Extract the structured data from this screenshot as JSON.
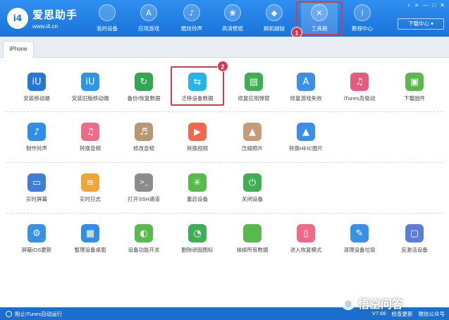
{
  "brand": {
    "logo": "i4",
    "name": "爱思助手",
    "url": "www.i4.cn"
  },
  "nav": {
    "items": [
      {
        "label": "我的设备",
        "icon": "apple-icon",
        "glyph": ""
      },
      {
        "label": "应用游戏",
        "icon": "app-store-icon",
        "glyph": "A"
      },
      {
        "label": "酷炫铃声",
        "icon": "bell-icon",
        "glyph": "♪"
      },
      {
        "label": "高清壁纸",
        "icon": "flower-icon",
        "glyph": "❀"
      },
      {
        "label": "刷机越狱",
        "icon": "dropbox-icon",
        "glyph": "◆"
      },
      {
        "label": "工具箱",
        "icon": "tools-icon",
        "glyph": "✕"
      },
      {
        "label": "教程中心",
        "icon": "info-icon",
        "glyph": "i"
      }
    ],
    "active_index": 5,
    "download_center": "下载中心 ▾"
  },
  "window_controls": [
    "♀",
    "≡",
    "—",
    "□",
    "✕"
  ],
  "badges": {
    "nav": "1",
    "tool": "2"
  },
  "tab": {
    "label": "iPhone"
  },
  "tools": {
    "row1": [
      {
        "label": "安装移动端",
        "icon": "i4-app-icon",
        "glyph": "iU",
        "color": "#2677d8"
      },
      {
        "label": "安装旧版移动端",
        "icon": "i4-legacy-app-icon",
        "glyph": "iU",
        "color": "#2f94e8"
      },
      {
        "label": "备份/恢复数据",
        "icon": "backup-restore-icon",
        "glyph": "↻",
        "color": "#33a853"
      },
      {
        "label": "迁移设备数据",
        "icon": "migrate-data-icon",
        "glyph": "⇆",
        "color": "#26b5e8"
      },
      {
        "label": "修复应用弹窗",
        "icon": "fix-app-popup-icon",
        "glyph": "▤",
        "color": "#3fae55"
      },
      {
        "label": "修复游戏失效",
        "icon": "fix-game-icon",
        "glyph": "A",
        "color": "#3a8fe6"
      },
      {
        "label": "iTunes及驱动",
        "icon": "itunes-icon",
        "glyph": "♫",
        "color": "#e45c7d"
      },
      {
        "label": "下载固件",
        "icon": "firmware-icon",
        "glyph": "▣",
        "color": "#5bb84a"
      }
    ],
    "row2": [
      {
        "label": "制作铃声",
        "icon": "ringtone-icon",
        "glyph": "♪",
        "color": "#2f8ee6"
      },
      {
        "label": "转换音频",
        "icon": "convert-audio-icon",
        "glyph": "♫",
        "color": "#ee6a86"
      },
      {
        "label": "修改音频",
        "icon": "edit-audio-icon",
        "glyph": "♬",
        "color": "#b89775"
      },
      {
        "label": "转换视频",
        "icon": "convert-video-icon",
        "glyph": "▶",
        "color": "#ef6a4c"
      },
      {
        "label": "压缩照片",
        "icon": "compress-photo-icon",
        "glyph": "▲",
        "color": "#c89b78"
      },
      {
        "label": "转换HEIC图片",
        "icon": "heic-icon",
        "glyph": "▲",
        "color": "#3a8fe6"
      }
    ],
    "row3": [
      {
        "label": "实时屏幕",
        "icon": "screen-icon",
        "glyph": "▭",
        "color": "#3d7fd6"
      },
      {
        "label": "实时日志",
        "icon": "log-icon",
        "glyph": "≡",
        "color": "#f0a53a"
      },
      {
        "label": "打开SSH通道",
        "icon": "ssh-icon",
        "glyph": ">_",
        "color": "#8c8c8c"
      },
      {
        "label": "重启设备",
        "icon": "restart-icon",
        "glyph": "✳",
        "color": "#58b94d"
      },
      {
        "label": "关闭设备",
        "icon": "power-icon",
        "glyph": "⏻",
        "color": "#3fae55"
      }
    ],
    "row4": [
      {
        "label": "屏蔽iOS更新",
        "icon": "block-update-icon",
        "glyph": "⚙",
        "color": "#3a8fe6"
      },
      {
        "label": "整理设备桌面",
        "icon": "desktop-icon",
        "glyph": "▦",
        "color": "#2f8ee6"
      },
      {
        "label": "设备功能开关",
        "icon": "switch-icon",
        "glyph": "◐",
        "color": "#58b94d"
      },
      {
        "label": "删除顽固图标",
        "icon": "delete-icon",
        "glyph": "◔",
        "color": "#3fae55"
      },
      {
        "label": "抹掉所有数据",
        "icon": "erase-icon",
        "glyph": "",
        "color": "#58b94d"
      },
      {
        "label": "进入恢复模式",
        "icon": "recovery-icon",
        "glyph": "▯",
        "color": "#ee6a86"
      },
      {
        "label": "清理设备垃圾",
        "icon": "clean-icon",
        "glyph": "✎",
        "color": "#3a8fe6"
      },
      {
        "label": "反激活设备",
        "icon": "deactivate-icon",
        "glyph": "▢",
        "color": "#5b7fd8"
      }
    ]
  },
  "status": {
    "itunes_toggle": "阻止iTunes自动运行",
    "version": "V7.66",
    "check_update": "检查更新",
    "wechat": "微信公众号"
  },
  "watermark": {
    "glyph": "◎",
    "text": "悟空问答"
  }
}
